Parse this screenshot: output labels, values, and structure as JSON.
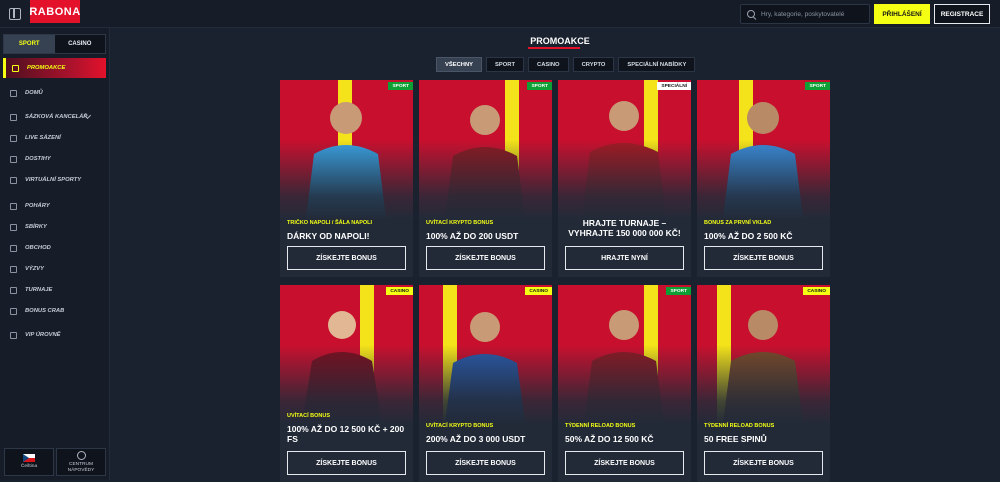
{
  "brand": {
    "logo_text": "RABONA",
    "accent": "#e4112b",
    "highlight": "#f4ff14"
  },
  "header": {
    "search_placeholder": "Hry, kategorie, poskytovatelé",
    "login_label": "PŘIHLÁŠENÍ",
    "register_label": "REGISTRACE"
  },
  "sidebar": {
    "tabs": [
      {
        "label": "SPORT",
        "active": true
      },
      {
        "label": "CASINO",
        "active": false
      }
    ],
    "active_item": {
      "label": "PROMOAKCE",
      "icon": "gift-icon"
    },
    "items": [
      {
        "label": "DOMŮ",
        "icon": "home-icon"
      },
      {
        "label": "SÁZKOVÁ KANCELÁŘ",
        "icon": "ticket-icon"
      },
      {
        "label": "LIVE SÁZENÍ",
        "icon": "live-icon"
      },
      {
        "label": "DOSTIHY",
        "icon": "horse-icon"
      },
      {
        "label": "VIRTUÁLNÍ SPORTY",
        "icon": "virtual-icon"
      },
      {
        "label": "POHÁRY",
        "icon": "trophy-icon"
      },
      {
        "label": "SBÍRKY",
        "icon": "collection-icon"
      },
      {
        "label": "OBCHOD",
        "icon": "cart-icon"
      },
      {
        "label": "VÝZVY",
        "icon": "flag-icon"
      },
      {
        "label": "TURNAJE",
        "icon": "tournament-icon"
      },
      {
        "label": "BONUS CRAB",
        "icon": "crab-icon"
      },
      {
        "label": "VIP ÚROVNĚ",
        "icon": "diamond-icon"
      }
    ],
    "language_label": "Čeština",
    "help_label_line1": "CENTRUM",
    "help_label_line2": "NÁPOVĚDY"
  },
  "main": {
    "title": "PROMOAKCE",
    "filters": [
      {
        "label": "VŠECHNY",
        "active": true
      },
      {
        "label": "SPORT",
        "active": false
      },
      {
        "label": "CASINO",
        "active": false
      },
      {
        "label": "CRYPTO",
        "active": false
      },
      {
        "label": "SPECIÁLNÍ NABÍDKY",
        "active": false
      }
    ],
    "cards": [
      {
        "badge": "SPORT",
        "badge_type": "sport",
        "eyebrow": "TRIČKO NAPOLI / ŠÁLA NAPOLI",
        "headline": "DÁRKY OD NAPOLI!",
        "cta": "ZÍSKEJTE BONUS",
        "shirt": "#3aa0e0"
      },
      {
        "badge": "SPORT",
        "badge_type": "sport",
        "eyebrow": "UVÍTACÍ KRYPTO BONUS",
        "headline": "100% AŽ DO 200 USDT",
        "cta": "ZÍSKEJTE BONUS",
        "shirt": "#8b1a22"
      },
      {
        "badge": "SPECIÁLNÍ",
        "badge_type": "special",
        "eyebrow": "",
        "headline": "HRAJTE TURNAJE – VYHRAJTE 150 000 000 KČ!",
        "cta": "HRAJTE NYNÍ",
        "shirt": "#a01a24"
      },
      {
        "badge": "SPORT",
        "badge_type": "sport",
        "eyebrow": "BONUS ZA PRVNÍ VKLAD",
        "headline": "100% AŽ DO 2 500 KČ",
        "cta": "ZÍSKEJTE BONUS",
        "shirt": "#3a8ad6"
      },
      {
        "badge": "CASINO",
        "badge_type": "casino",
        "eyebrow": "UVÍTACÍ BONUS",
        "headline": "100% AŽ DO 12 500 KČ + 200 FS",
        "cta": "ZÍSKEJTE BONUS",
        "shirt": "#7a1020"
      },
      {
        "badge": "CASINO",
        "badge_type": "casino",
        "eyebrow": "UVÍTACÍ KRYPTO BONUS",
        "headline": "200% AŽ DO 3 000 USDT",
        "cta": "ZÍSKEJTE BONUS",
        "shirt": "#2a5aa8"
      },
      {
        "badge": "SPORT",
        "badge_type": "sport",
        "eyebrow": "TÝDENNÍ RELOAD BONUS",
        "headline": "50% AŽ DO 12 500 KČ",
        "cta": "ZÍSKEJTE BONUS",
        "shirt": "#8a1a24"
      },
      {
        "badge": "CASINO",
        "badge_type": "casino",
        "eyebrow": "TÝDENNÍ RELOAD BONUS",
        "headline": "50 FREE SPINŮ",
        "cta": "ZÍSKEJTE BONUS",
        "shirt": "#7a4a2a"
      }
    ]
  }
}
